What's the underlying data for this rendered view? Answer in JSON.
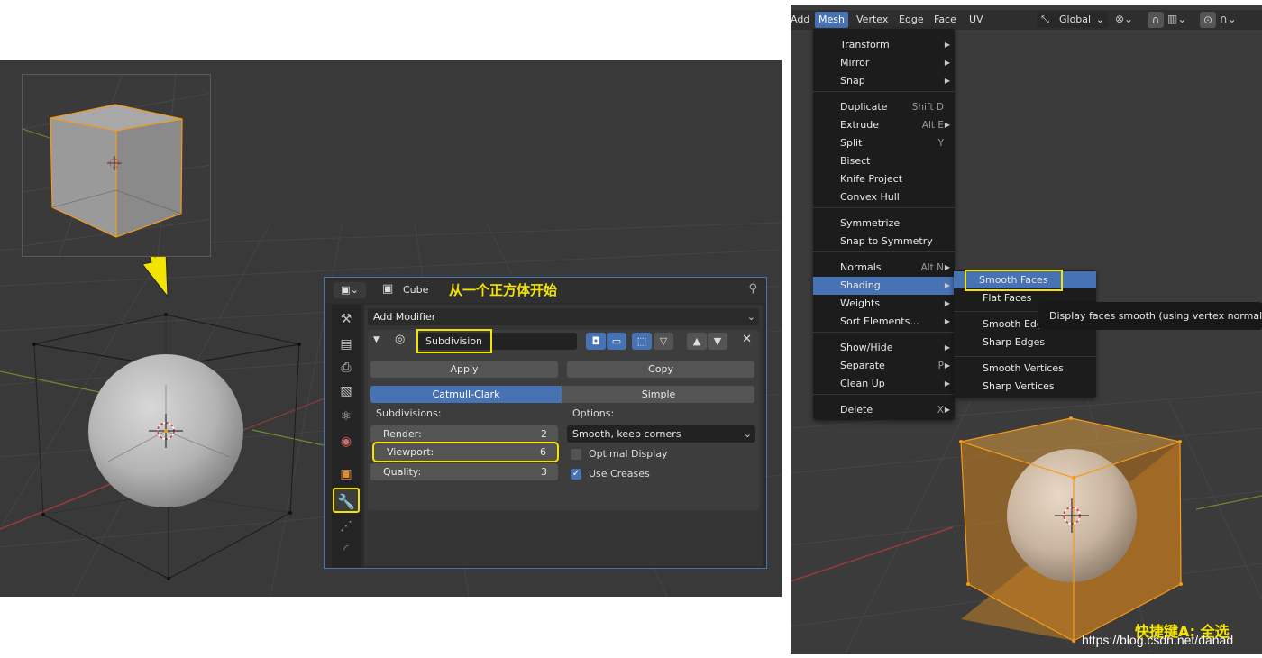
{
  "left": {
    "annotation": "从一个正方体开始",
    "header": {
      "object_name": "Cube"
    },
    "add_modifier": "Add Modifier",
    "modifier": {
      "name": "Subdivision",
      "apply": "Apply",
      "copy": "Copy",
      "mode_tabs": [
        "Catmull-Clark",
        "Simple"
      ],
      "subdivisions_label": "Subdivisions:",
      "options_label": "Options:",
      "render_label": "Render:",
      "render_value": "2",
      "viewport_label": "Viewport:",
      "viewport_value": "6",
      "quality_label": "Quality:",
      "quality_value": "3",
      "uv_smooth": "Smooth, keep corners",
      "optimal_display": "Optimal Display",
      "use_creases": "Use Creases"
    }
  },
  "right": {
    "menubar": [
      "Add",
      "Mesh",
      "Vertex",
      "Edge",
      "Face",
      "UV"
    ],
    "orientation": "Global",
    "mesh_menu": [
      {
        "label": "Transform",
        "shortcut": "",
        "submenu": true
      },
      {
        "label": "Mirror",
        "shortcut": "",
        "submenu": true
      },
      {
        "label": "Snap",
        "shortcut": "",
        "submenu": true
      },
      {
        "label": "Duplicate",
        "shortcut": "Shift D",
        "submenu": false
      },
      {
        "label": "Extrude",
        "shortcut": "Alt E",
        "submenu": true
      },
      {
        "label": "Split",
        "shortcut": "Y",
        "submenu": false
      },
      {
        "label": "Bisect",
        "shortcut": "",
        "submenu": false
      },
      {
        "label": "Knife Project",
        "shortcut": "",
        "submenu": false
      },
      {
        "label": "Convex Hull",
        "shortcut": "",
        "submenu": false
      },
      {
        "label": "Symmetrize",
        "shortcut": "",
        "submenu": false
      },
      {
        "label": "Snap to Symmetry",
        "shortcut": "",
        "submenu": false
      },
      {
        "label": "Normals",
        "shortcut": "Alt N",
        "submenu": true
      },
      {
        "label": "Shading",
        "shortcut": "",
        "submenu": true
      },
      {
        "label": "Weights",
        "shortcut": "",
        "submenu": true
      },
      {
        "label": "Sort Elements...",
        "shortcut": "",
        "submenu": true
      },
      {
        "label": "Show/Hide",
        "shortcut": "",
        "submenu": true
      },
      {
        "label": "Separate",
        "shortcut": "P",
        "submenu": true
      },
      {
        "label": "Clean Up",
        "shortcut": "",
        "submenu": true
      },
      {
        "label": "Delete",
        "shortcut": "X",
        "submenu": true
      }
    ],
    "shading_menu": [
      "Smooth Faces",
      "Flat Faces",
      "Smooth Edges",
      "Sharp Edges",
      "Smooth Vertices",
      "Sharp Vertices"
    ],
    "tooltip": "Display faces smooth (using vertex normals).",
    "annotation": "快捷键A: 全选",
    "watermark": "https://blog.csdn.net/danad"
  },
  "colors": {
    "accent": "#4772b3",
    "highlight": "#f2e400",
    "selection_orange": "#f29a1b"
  }
}
